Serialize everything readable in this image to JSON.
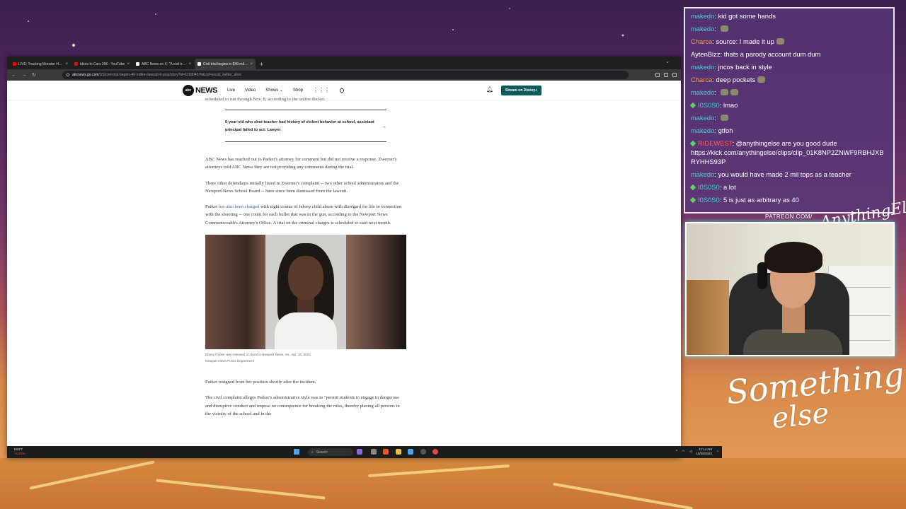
{
  "browser": {
    "tabs": [
      {
        "title": "LIVE: Tracking Monster Hurricane",
        "active": false,
        "favicon": "youtube-icon",
        "color": "#ff0000"
      },
      {
        "title": "Idiots In Cars 266 - YouTube",
        "active": false,
        "favicon": "youtube-icon",
        "color": "#ff0000"
      },
      {
        "title": "ABC News on X: \"A civil trial is",
        "active": false,
        "favicon": "x-icon",
        "color": "#ffffff"
      },
      {
        "title": "Civil trial begins in $40 million",
        "active": true,
        "favicon": "abc-icon",
        "color": "#ffffff"
      }
    ],
    "url_domain": "abcnews.go.com",
    "url_path": "/US/civil-trial-begins-40-million-lawsuit-6-year/story?id=116904576&cid=social_twitter_abcn"
  },
  "site": {
    "logo_mark": "abc",
    "logo_news": "NEWS",
    "nav": [
      "Live",
      "Video",
      "Shows",
      "Shop"
    ],
    "stream_button": "Stream on Disney+"
  },
  "article": {
    "top_fragment": "scheduled to run through Nov. 8, according to the online docket.",
    "related_text": "6-year-old who shot teacher had history of violent behavior at school, assistant principal failed to act: Lawyer",
    "p1": "ABC News has reached out to Parker's attorney for comment but did not receive a response. Zwerner's attorneys told ABC News they are not providing any comments during the trial.",
    "p2": "Three other defendants initially listed in Zwerner's complaint -- two other school administrators and the Newport News School Board -- have since been dismissed from the lawsuit.",
    "p3_pre": "Parker ",
    "p3_link": "has also been charged",
    "p3_post": " with eight counts of felony child abuse with disregard for life in connection with the shooting -- one count for each bullet that was in the gun, according to the Newport News Commonwealth's Attorney's Office. A trial on the criminal charges is scheduled to start next month.",
    "caption": "Ebony Parker was released on bond in Newport News, Va., Apr. 10, 2024.",
    "credit": "Newport News Police Department",
    "p4": "Parker resigned from her position shortly after the incident.",
    "p5": "The civil complaint alleges Parker's administrative style was to \"permit students to engage in dangerous and disruptive conduct and impose no consequence for breaking the rules, thereby placing all persons in the vicinity of the school and in the"
  },
  "taskbar": {
    "stock_name": "MSFT",
    "stock_change": "+1.01%",
    "search_placeholder": "Search",
    "time": "11:14 AM",
    "date": "10/28/2024"
  },
  "chat": {
    "messages": [
      {
        "user": "makedo",
        "color": "#4fd0d0",
        "text": "kid got some hands",
        "emotes": 0,
        "badge": false
      },
      {
        "user": "makedo",
        "color": "#4fd0d0",
        "text": "",
        "emotes": 1,
        "badge": false
      },
      {
        "user": "Charca",
        "color": "#f5a040",
        "text": "source: I made it up",
        "emotes": 1,
        "badge": false
      },
      {
        "user": "AytenBizz",
        "color": "#ffffff",
        "text": "thats a parody account dum dum",
        "emotes": 0,
        "badge": false
      },
      {
        "user": "makedo",
        "color": "#4fd0d0",
        "text": "jncos back in style",
        "emotes": 0,
        "badge": false
      },
      {
        "user": "Charca",
        "color": "#f5a040",
        "text": "deep pockets",
        "emotes": 1,
        "badge": false
      },
      {
        "user": "makedo",
        "color": "#4fd0d0",
        "text": "",
        "emotes": 2,
        "badge": false
      },
      {
        "user": "I0S0S0",
        "color": "#3ad0d0",
        "text": "lmao",
        "emotes": 0,
        "badge": true
      },
      {
        "user": "makedo",
        "color": "#4fd0d0",
        "text": "",
        "emotes": 1,
        "badge": false
      },
      {
        "user": "makedo",
        "color": "#4fd0d0",
        "text": "gtfoh",
        "emotes": 0,
        "badge": false
      },
      {
        "user": "RIDEWEST",
        "color": "#ff5a5a",
        "text": "@anythingelse are you good dude https://kick.com/anythingelse/clips/clip_01K8NP2ZNWF9RBHJXBRYHHS93P",
        "emotes": 0,
        "badge": true
      },
      {
        "user": "makedo",
        "color": "#4fd0d0",
        "text": "you would have made 2 mil tops as a teacher",
        "emotes": 0,
        "badge": false
      },
      {
        "user": "I0S0S0",
        "color": "#3ad0d0",
        "text": "a lot",
        "emotes": 0,
        "badge": true
      },
      {
        "user": "I0S0S0",
        "color": "#3ad0d0",
        "text": "5 is just as arbitrary as 40",
        "emotes": 0,
        "badge": true
      }
    ]
  },
  "overlay": {
    "patreon": "PATREON.COM/",
    "signature_small": "AnythingElse",
    "logo_line1": "Something",
    "logo_line2": "else"
  }
}
